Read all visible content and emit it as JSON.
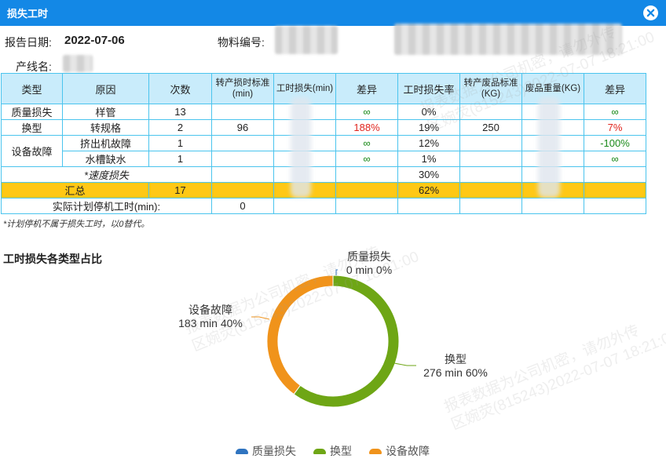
{
  "dialog": {
    "title": "损失工时",
    "close_icon": "close-icon"
  },
  "header": {
    "report_date_label": "报告日期:",
    "report_date": "2022-07-06",
    "material_label": "物料编号:",
    "line_label": "产线名:"
  },
  "table": {
    "headers": [
      "类型",
      "原因",
      "次数",
      "转产损时标准(min)",
      "工时损失(min)",
      "差异",
      "工时损失率",
      "转产废品标准(KG)",
      "废品重量(KG)",
      "差异"
    ],
    "rows": {
      "r1": {
        "type": "质量损失",
        "reason": "样管",
        "count": "13",
        "std": "",
        "loss": "",
        "diff": "∞",
        "rate": "0%",
        "waste_std": "",
        "waste": "",
        "diff2": "∞"
      },
      "r2": {
        "type": "换型",
        "reason": "转规格",
        "count": "2",
        "std": "96",
        "loss": "",
        "diff": "188%",
        "rate": "19%",
        "waste_std": "250",
        "waste": "",
        "diff2": "7%"
      },
      "r3": {
        "type": "设备故障",
        "reason": "挤出机故障",
        "count": "1",
        "std": "",
        "loss": "",
        "diff": "∞",
        "rate": "12%",
        "waste_std": "",
        "waste": "",
        "diff2": "-100%"
      },
      "r4": {
        "reason": "水槽缺水",
        "count": "1",
        "std": "",
        "loss": "",
        "diff": "∞",
        "rate": "1%",
        "waste_std": "",
        "waste": "",
        "diff2": "∞"
      },
      "speed": {
        "label": "*速度损失",
        "rate": "30%"
      },
      "total": {
        "label": "汇总",
        "count": "17",
        "rate": "62%"
      },
      "planned": {
        "label": "实际计划停机工时(min):",
        "value": "0"
      }
    }
  },
  "note": "*计划停机不属于损失工时，以0替代。",
  "chart_data": {
    "type": "pie",
    "title": "工时损失各类型占比",
    "categories": [
      "质量损失",
      "换型",
      "设备故障"
    ],
    "values": [
      0,
      276,
      183
    ],
    "units": "min",
    "percent_labels": [
      "0%",
      "60%",
      "40%"
    ],
    "value_labels": [
      "0 min",
      "276 min",
      "183 min"
    ],
    "colors": [
      "#2f74c0",
      "#6ea615",
      "#f0931b"
    ],
    "legend": "bottom-center",
    "donut": true
  },
  "watermark": {
    "line1": "报表数据为公司机密，请勿外传",
    "line2": "区婉荧(815243)2022-07-07 18:21:00"
  }
}
